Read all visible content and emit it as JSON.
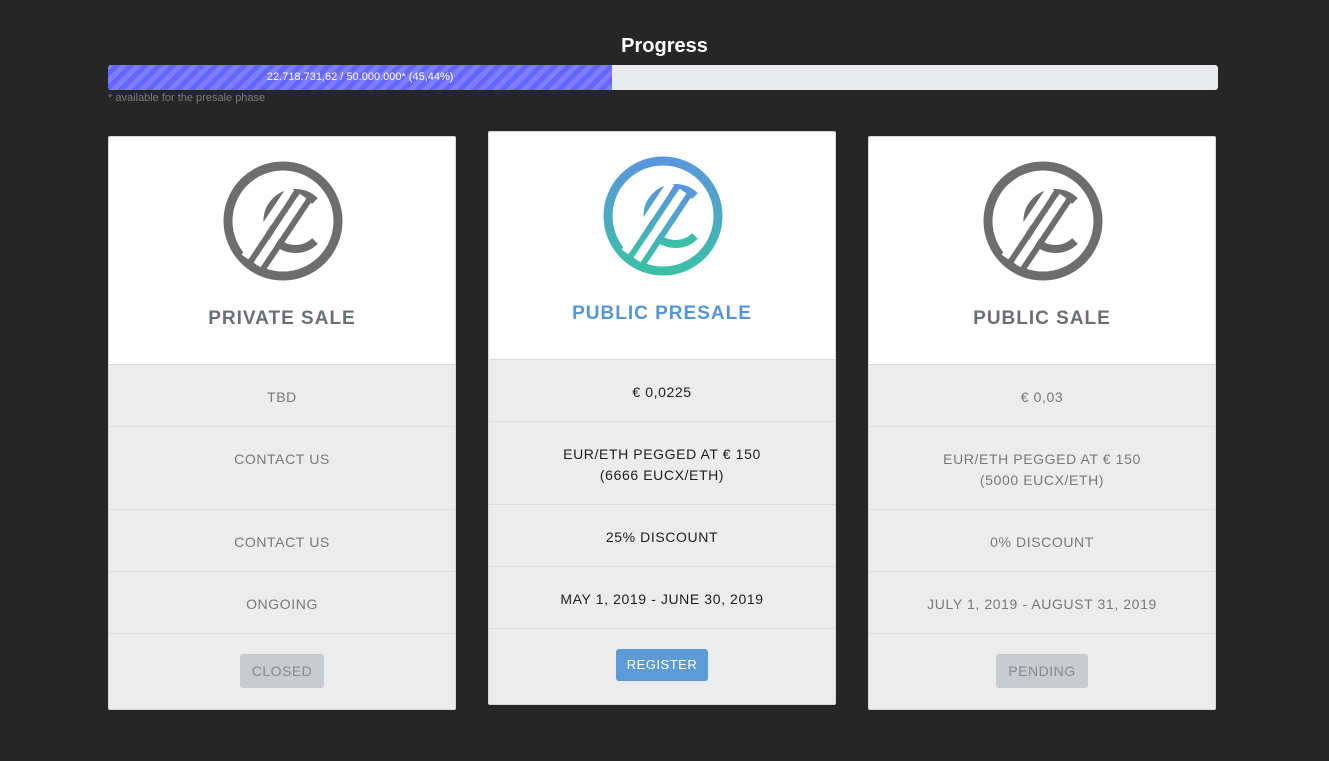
{
  "progress": {
    "title": "Progress",
    "text": "22.718.731,62 / 50.000.000* (45,44%)",
    "percent": 45.44,
    "fill_color": "#6466ff",
    "footnote": "* available for the presale phase"
  },
  "cards": [
    {
      "title": "PRIVATE SALE",
      "logo_icon": "euro-coin-icon",
      "logo_color": "#6d6d6d",
      "price": "TBD",
      "peg_line1": "CONTACT US",
      "peg_line2": "",
      "discount": "CONTACT US",
      "period": "ONGOING",
      "button": "CLOSED"
    },
    {
      "title": "PUBLIC PRESALE",
      "logo_icon": "euro-coin-icon",
      "logo_gradient": [
        "#5a97dd",
        "#3bbfa6"
      ],
      "price": "€ 0,0225",
      "peg_line1": "EUR/ETH PEGGED AT € 150",
      "peg_line2": "(6666 EUCX/ETH)",
      "discount": "25% DISCOUNT",
      "period": "MAY 1, 2019 - JUNE 30, 2019",
      "button": "REGISTER"
    },
    {
      "title": "PUBLIC SALE",
      "logo_icon": "euro-coin-icon",
      "logo_color": "#6d6d6d",
      "price": "€ 0,03",
      "peg_line1": "EUR/ETH PEGGED AT € 150",
      "peg_line2": "(5000 EUCX/ETH)",
      "discount": "0% DISCOUNT",
      "period": "JULY 1, 2019 - AUGUST 31, 2019",
      "button": "PENDING"
    }
  ]
}
